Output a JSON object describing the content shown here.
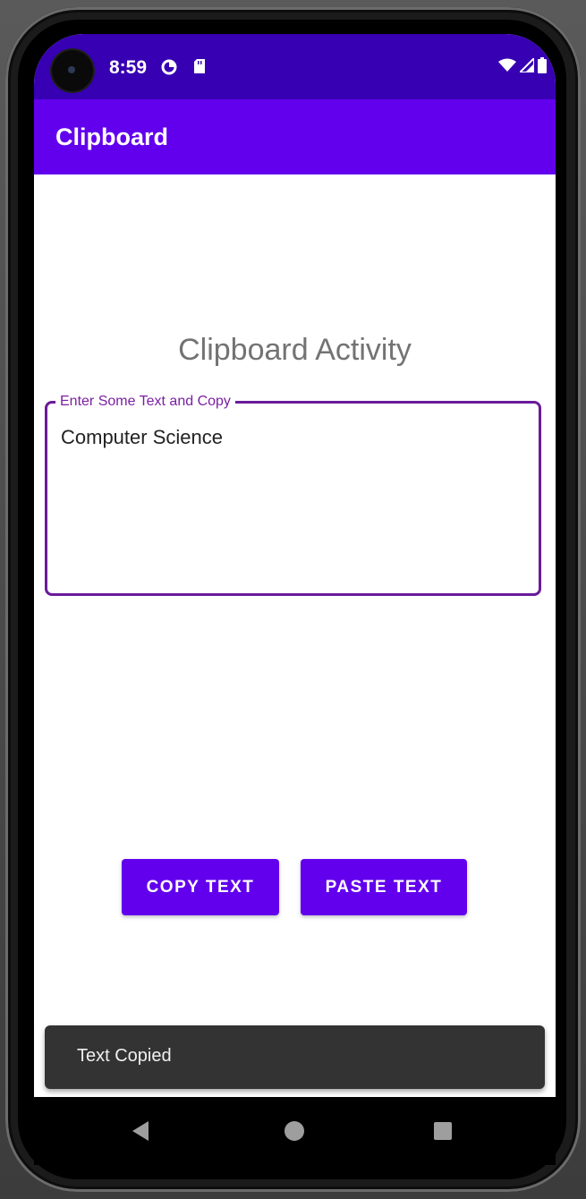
{
  "status_bar": {
    "time": "8:59",
    "icons": [
      "data-saver-icon",
      "sd-card-icon",
      "wifi-icon",
      "signal-icon",
      "battery-icon"
    ]
  },
  "app_bar": {
    "title": "Clipboard"
  },
  "main": {
    "heading": "Clipboard Activity",
    "text_field": {
      "label": "Enter Some Text and Copy",
      "value": "Computer Science"
    },
    "buttons": {
      "copy_label": "COPY TEXT",
      "paste_label": "PASTE TEXT"
    }
  },
  "snackbar": {
    "message": "Text Copied"
  },
  "navigation_bar": {
    "icons": [
      "back-icon",
      "home-icon",
      "recents-icon"
    ]
  },
  "colors": {
    "status_bar": "#3700b3",
    "app_bar": "#6200ee",
    "button": "#6200ee",
    "field_outline": "#6a1b9a",
    "snackbar": "#333333"
  }
}
